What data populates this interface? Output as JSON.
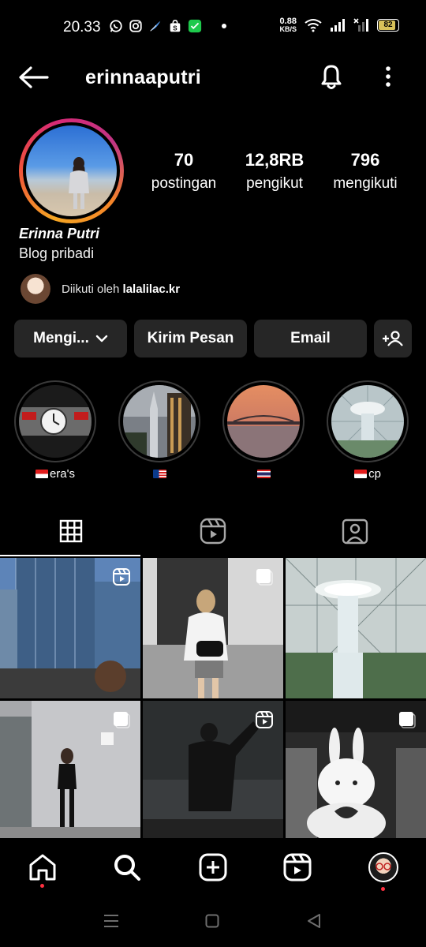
{
  "status_bar": {
    "time": "20.33",
    "net_speed_value": "0.88",
    "net_speed_unit": "KB/S",
    "battery": "82",
    "icons": [
      "whatsapp-icon",
      "instagram-icon",
      "feather-icon",
      "shopee-icon",
      "wechat-icon",
      "dot-icon",
      "wifi-icon",
      "signal-icon",
      "signal-x-icon",
      "battery-icon"
    ]
  },
  "topbar": {
    "username": "erinnaaputri",
    "icons": [
      "back-arrow-icon",
      "bell-icon",
      "more-vertical-icon"
    ]
  },
  "profile": {
    "posts_count": "70",
    "posts_label": "postingan",
    "followers_count": "12,8RB",
    "followers_label": "pengikut",
    "following_count": "796",
    "following_label": "mengikuti",
    "full_name": "Erinna Putri",
    "bio": "Blog pribadi",
    "followed_by_prefix": "Diikuti oleh ",
    "followed_by_user": "lalalilac.kr"
  },
  "actions": {
    "following": "Mengi...",
    "message": "Kirim Pesan",
    "email": "Email"
  },
  "highlights": [
    {
      "label": "era's"
    },
    {
      "label": ""
    },
    {
      "label": ""
    },
    {
      "label": "cp"
    }
  ],
  "tabs": [
    "grid-icon",
    "reels-icon",
    "tagged-icon"
  ],
  "grid": {
    "rows": 2,
    "cols": 3,
    "badges": [
      "reels",
      "multi",
      "none",
      "multi",
      "reels",
      "multi"
    ]
  },
  "bottom_nav": [
    "home-icon",
    "search-icon",
    "create-icon",
    "reels-icon",
    "profile-avatar"
  ],
  "colors": {
    "background": "#000000",
    "button": "#262626",
    "notification_dot": "#ff3040"
  }
}
